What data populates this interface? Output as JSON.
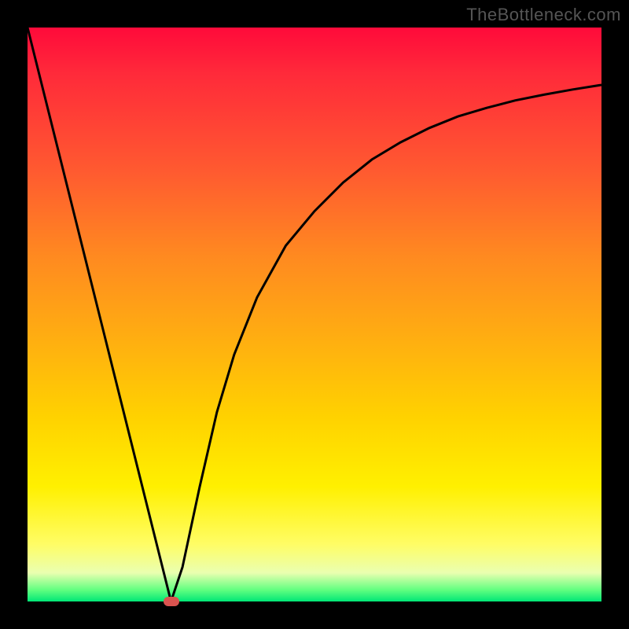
{
  "attribution": "TheBottleneck.com",
  "colors": {
    "frame": "#000000",
    "gradient_top": "#ff0a3a",
    "gradient_bottom": "#00e676",
    "curve": "#000000",
    "marker": "#d9534f"
  },
  "chart_data": {
    "type": "line",
    "title": "",
    "xlabel": "",
    "ylabel": "",
    "xlim": [
      0,
      100
    ],
    "ylim": [
      0,
      100
    ],
    "series": [
      {
        "name": "curve",
        "x": [
          0,
          5,
          10,
          15,
          20,
          22,
          24,
          25,
          27,
          30,
          33,
          36,
          40,
          45,
          50,
          55,
          60,
          65,
          70,
          75,
          80,
          85,
          90,
          95,
          100
        ],
        "values": [
          100,
          80,
          60,
          40,
          20,
          12,
          4,
          0,
          6,
          20,
          33,
          43,
          53,
          62,
          68,
          73,
          77,
          80,
          82.5,
          84.5,
          86,
          87.3,
          88.3,
          89.2,
          90
        ]
      }
    ],
    "marker": {
      "x": 25,
      "y": 0
    }
  }
}
